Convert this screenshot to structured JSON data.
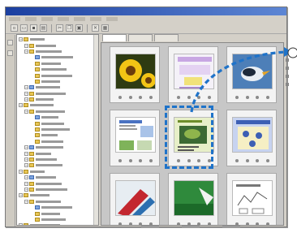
{
  "window": {
    "title": "",
    "menu": [
      "",
      "",
      "",
      "",
      "",
      "",
      ""
    ]
  },
  "toolbar": {
    "buttons": [
      {
        "icon": "new-icon"
      },
      {
        "icon": "open-icon"
      },
      {
        "icon": "save-icon"
      },
      {
        "icon": "print-icon"
      },
      {
        "icon": "cut-icon"
      },
      {
        "icon": "copy-icon"
      },
      {
        "icon": "paste-icon"
      },
      {
        "icon": "delete-icon"
      },
      {
        "icon": "view-icon"
      }
    ]
  },
  "tabs": [
    {
      "label": "",
      "active": true
    },
    {
      "label": "",
      "active": false
    },
    {
      "label": "",
      "active": false
    }
  ],
  "tree": {
    "items": [
      {
        "label": "",
        "depth": 0
      },
      {
        "label": "",
        "depth": 1
      },
      {
        "label": "",
        "depth": 1
      },
      {
        "label": "",
        "depth": 2
      },
      {
        "label": "",
        "depth": 2
      },
      {
        "label": "",
        "depth": 2
      },
      {
        "label": "",
        "depth": 2
      },
      {
        "label": "",
        "depth": 2
      },
      {
        "label": "",
        "depth": 1
      },
      {
        "label": "",
        "depth": 1
      },
      {
        "label": "",
        "depth": 1
      },
      {
        "label": "",
        "depth": 0
      },
      {
        "label": "",
        "depth": 1
      },
      {
        "label": "",
        "depth": 2
      },
      {
        "label": "",
        "depth": 2
      },
      {
        "label": "",
        "depth": 2
      },
      {
        "label": "",
        "depth": 2
      },
      {
        "label": "",
        "depth": 2
      },
      {
        "label": "",
        "depth": 1
      },
      {
        "label": "",
        "depth": 1
      },
      {
        "label": "",
        "depth": 1
      },
      {
        "label": "",
        "depth": 1
      },
      {
        "label": "",
        "depth": 0
      },
      {
        "label": "",
        "depth": 1
      },
      {
        "label": "",
        "depth": 1
      },
      {
        "label": "",
        "depth": 1
      },
      {
        "label": "",
        "depth": 0
      },
      {
        "label": "",
        "depth": 1
      },
      {
        "label": "",
        "depth": 2
      },
      {
        "label": "",
        "depth": 2
      },
      {
        "label": "",
        "depth": 2
      },
      {
        "label": "",
        "depth": 0
      }
    ]
  },
  "thumbnails": [
    {
      "caption": "",
      "kind": "sunflower"
    },
    {
      "caption": "",
      "kind": "purple-doc"
    },
    {
      "caption": "",
      "kind": "bird"
    },
    {
      "caption": "",
      "kind": "flyer-doc"
    },
    {
      "caption": "",
      "kind": "green-flyer",
      "highlighted": true
    },
    {
      "caption": "",
      "kind": "blue-card"
    },
    {
      "caption": "",
      "kind": "red-photo"
    },
    {
      "caption": "",
      "kind": "green-photo"
    },
    {
      "caption": "",
      "kind": "sketch-doc"
    }
  ],
  "status": [
    "",
    "",
    ""
  ],
  "colors": {
    "highlight": "#1f73c9",
    "titlebar": "#1b3fa0"
  }
}
